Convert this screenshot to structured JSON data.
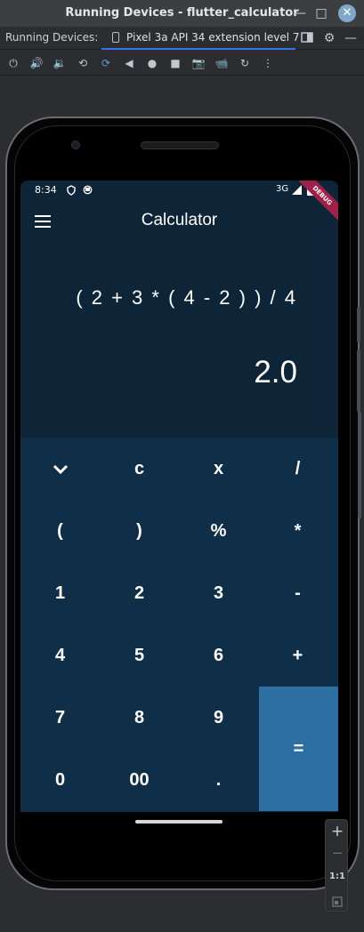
{
  "window": {
    "title": "Running Devices - flutter_calculator",
    "minimize": "—",
    "maximize": "□",
    "close": "✕"
  },
  "tabs": {
    "label": "Running Devices:",
    "active_tab": "Pixel 3a API 34 extension level 7"
  },
  "toolbar": {
    "icons": [
      "power-icon",
      "volume-up-icon",
      "volume-down-icon",
      "rotate-left-icon",
      "rotate-right-icon",
      "back-icon",
      "home-icon",
      "overview-icon",
      "screenshot-icon",
      "screen-record-icon",
      "snapshot-icon",
      "more-icon"
    ]
  },
  "device": {
    "status_time": "8:34",
    "network": "3G",
    "debug_banner": "DEBUG"
  },
  "app": {
    "title": "Calculator",
    "expression": "( 2 + 3 * ( 4 - 2 ) ) / 4",
    "result": "2.0",
    "keys": [
      [
        "⌄",
        "c",
        "x",
        "/"
      ],
      [
        "(",
        ")",
        "%",
        "*"
      ],
      [
        "1",
        "2",
        "3",
        "-"
      ],
      [
        "4",
        "5",
        "6",
        "+"
      ],
      [
        "7",
        "8",
        "9",
        "="
      ],
      [
        "0",
        "00",
        "."
      ]
    ],
    "colors": {
      "background": "#0d2537",
      "keypad": "#0f2e48",
      "equals": "#2e6fa2"
    }
  },
  "zoom": {
    "zoom_in": "+",
    "zoom_out": "−",
    "actual": "1:1"
  }
}
